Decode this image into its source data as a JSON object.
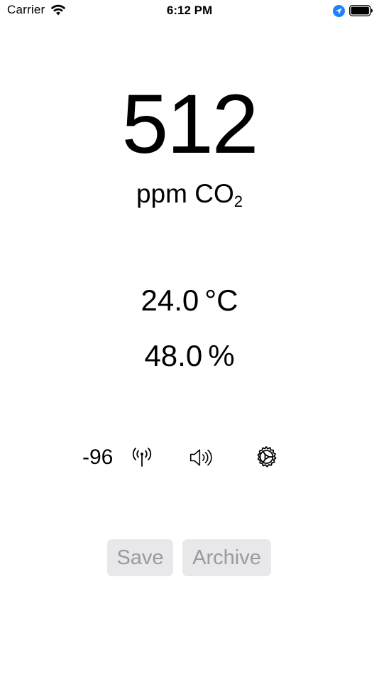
{
  "status_bar": {
    "carrier": "Carrier",
    "time": "6:12 PM",
    "wifi_icon": "wifi-icon",
    "location_icon": "location-arrow-icon",
    "battery_icon": "battery-icon",
    "location_color": "#1a82fb"
  },
  "readout": {
    "co2_value": "512",
    "co2_unit_prefix": "ppm CO",
    "co2_unit_subscript": "2",
    "temperature_value": "24.0",
    "temperature_unit": "°C",
    "humidity_value": "48.0",
    "humidity_unit": "%"
  },
  "controls": {
    "rssi": "-96",
    "antenna_icon": "antenna-icon",
    "speaker_icon": "speaker-icon",
    "settings_icon": "gear-icon"
  },
  "buttons": {
    "save_label": "Save",
    "archive_label": "Archive",
    "background": "#e8e8ea",
    "text_color": "#9a9a9e"
  }
}
